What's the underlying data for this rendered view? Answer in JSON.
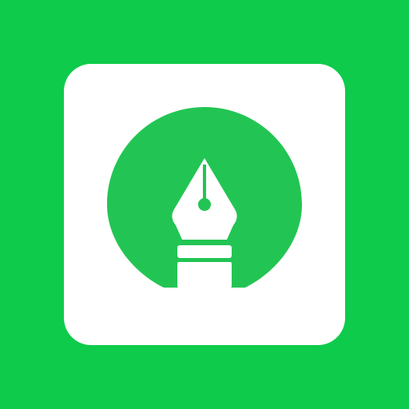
{
  "app_icon": {
    "name": "pen-nib-app-icon",
    "colors": {
      "background": "#0ecb4b",
      "tile": "#ffffff",
      "badge": "#22c553",
      "nib": "#ffffff"
    },
    "icons": [
      "rounded-square-tile",
      "circle-badge",
      "fountain-pen-nib-icon"
    ]
  }
}
